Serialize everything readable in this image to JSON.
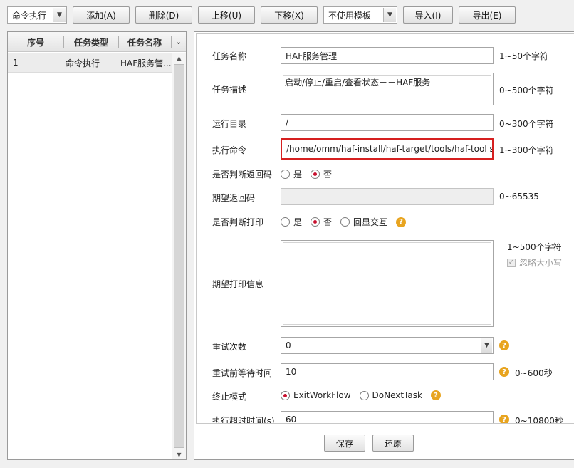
{
  "toolbar": {
    "task_type_select": "命令执行",
    "add": "添加(A)",
    "delete": "删除(D)",
    "move_up": "上移(U)",
    "move_down": "下移(X)",
    "template_select": "不使用模板",
    "import": "导入(I)",
    "export": "导出(E)"
  },
  "task_list": {
    "columns": [
      "序号",
      "任务类型",
      "任务名称"
    ],
    "rows": [
      {
        "index": "1",
        "type": "命令执行",
        "name": "HAF服务管..."
      }
    ]
  },
  "form": {
    "task_name": {
      "label": "任务名称",
      "value": "HAF服务管理",
      "hint": "1~50个字符"
    },
    "task_desc": {
      "label": "任务描述",
      "value": "启动/停止/重启/查看状态－－HAF服务",
      "hint": "0~500个字符"
    },
    "run_dir": {
      "label": "运行目录",
      "value": "/",
      "hint": "0~300个字符"
    },
    "exec_cmd": {
      "label": "执行命令",
      "value": "/home/omm/haf-install/haf-target/tools/haf-tool start",
      "hint": "1~300个字符"
    },
    "check_return_code": {
      "label": "是否判断返回码",
      "options": [
        "是",
        "否"
      ],
      "selected": "否"
    },
    "expected_return_code": {
      "label": "期望返回码",
      "value": "",
      "hint": "0~65535"
    },
    "check_print": {
      "label": "是否判断打印",
      "options": [
        "是",
        "否",
        "回显交互"
      ],
      "selected": "否"
    },
    "expected_print": {
      "label": "期望打印信息",
      "value": "",
      "hint": "1~500个字符",
      "ignore_case_label": "忽略大小写"
    },
    "retry_count": {
      "label": "重试次数",
      "value": "0"
    },
    "retry_wait": {
      "label": "重试前等待时间",
      "value": "10",
      "hint": "0~600秒"
    },
    "terminate_mode": {
      "label": "终止模式",
      "options": [
        "ExitWorkFlow",
        "DoNextTask"
      ],
      "selected": "ExitWorkFlow"
    },
    "exec_timeout": {
      "label": "执行超时时间(s)",
      "value": "60",
      "hint": "0~10800秒"
    }
  },
  "footer": {
    "save": "保存",
    "reset": "还原"
  },
  "colors": {
    "accent_radio": "#c8102e",
    "highlight_border": "#d62020",
    "help_icon": "#e8a41f"
  }
}
